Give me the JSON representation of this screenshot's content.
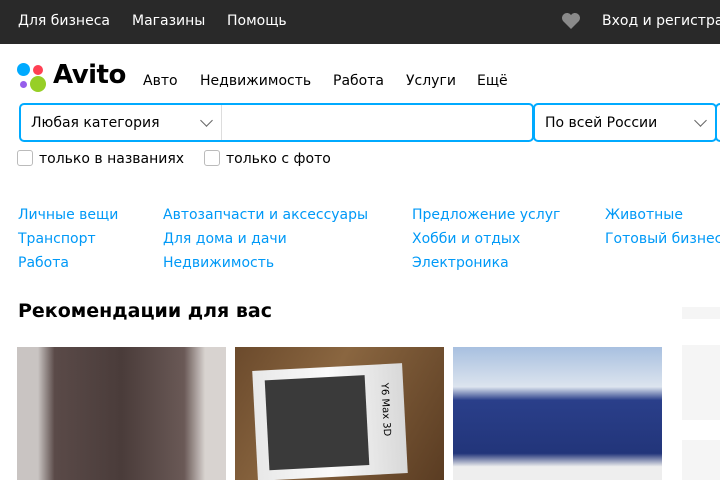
{
  "topbar": {
    "business": "Для бизнеса",
    "shops": "Магазины",
    "help": "Помощь",
    "login": "Вход и регистрация"
  },
  "logo": {
    "text": "Avito"
  },
  "nav": [
    "Авто",
    "Недвижимость",
    "Работа",
    "Услуги",
    "Ещё"
  ],
  "search": {
    "category": "Любая категория",
    "query": "",
    "query_placeholder": "",
    "region": "По всей России"
  },
  "filters": {
    "titles_only": "только в названиях",
    "with_photo": "только с фото"
  },
  "categories": [
    [
      "Личные вещи",
      "Транспорт",
      "Работа"
    ],
    [
      "Автозапчасти и аксессуары",
      "Для дома и дачи",
      "Недвижимость"
    ],
    [
      "Предложение услуг",
      "Хобби и отдых",
      "Электроника"
    ],
    [
      "Животные",
      "Готовый бизнес"
    ]
  ],
  "recommendations": {
    "title": "Рекомендации для вас",
    "phone_label": "Y6 Max 3D"
  },
  "colors": {
    "accent": "#00aaff",
    "link": "#0099f7",
    "topbar": "#292929"
  }
}
